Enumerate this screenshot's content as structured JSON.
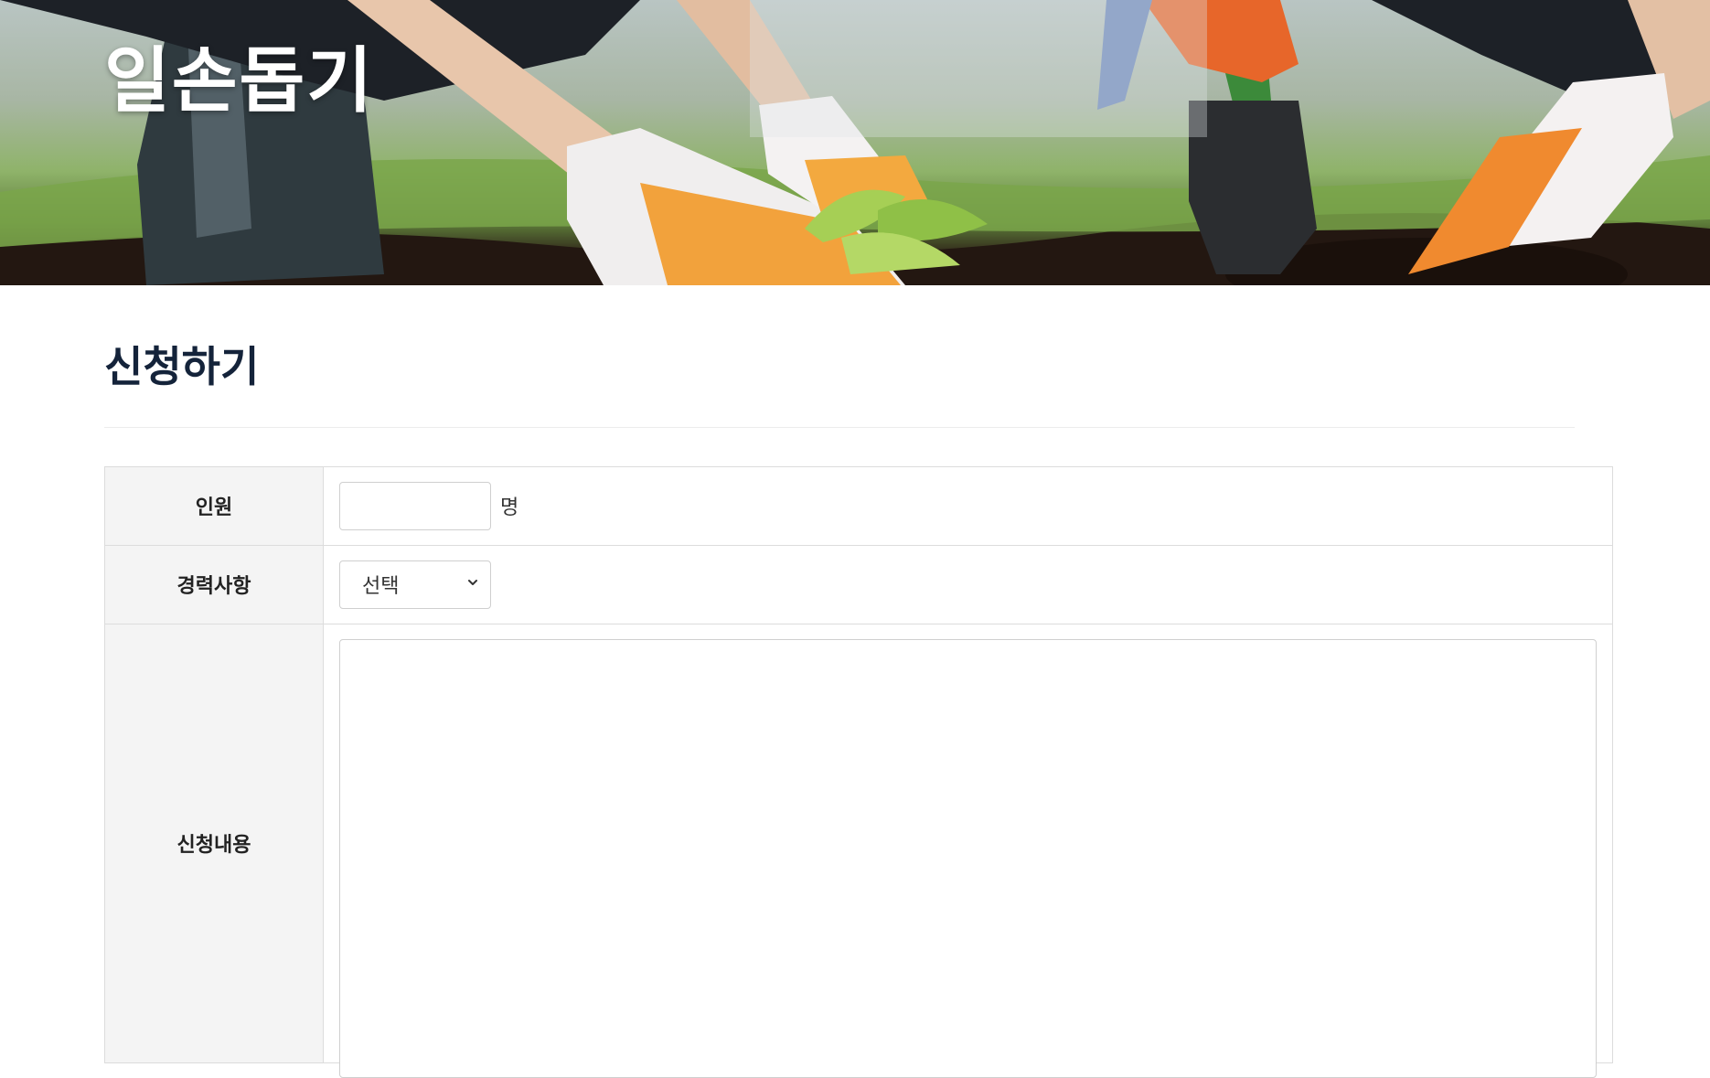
{
  "hero": {
    "title": "일손돕기",
    "image": "gardeners-planting-seedlings-photo"
  },
  "page": {
    "title": "신청하기"
  },
  "form": {
    "count": {
      "label": "인원",
      "value": "",
      "unit": "명"
    },
    "career": {
      "label": "경력사항",
      "selected": "선택"
    },
    "content": {
      "label": "신청내용",
      "value": ""
    }
  },
  "icons": {
    "select_arrow": "chevron-down-icon"
  },
  "colors": {
    "title": "#14233a",
    "label_bg": "#f4f4f4",
    "border": "#dcdcdc"
  }
}
